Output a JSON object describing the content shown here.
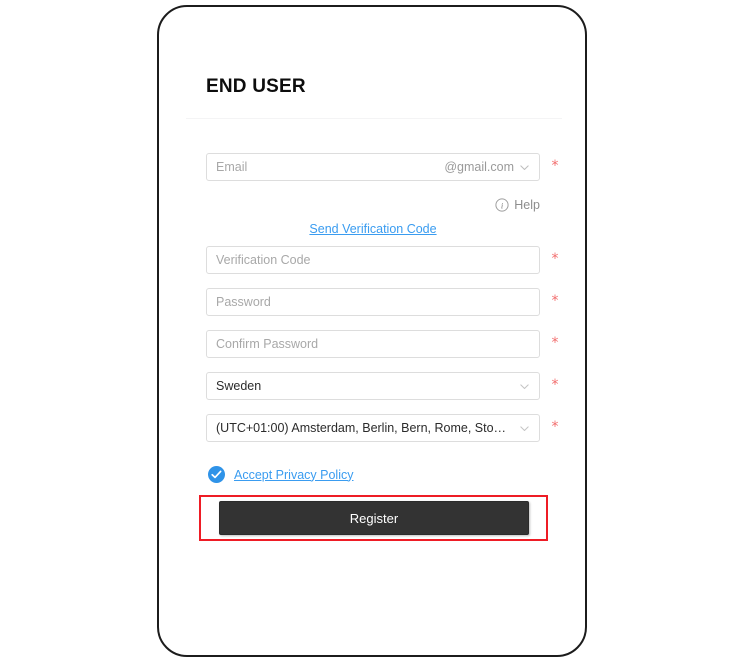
{
  "page": {
    "title": "END USER",
    "accent_link_color": "#3a9cf0",
    "required_star_color": "#f26d6d",
    "highlight_color": "#ee1c25",
    "button_color": "#333333",
    "checkbox_color": "#2f93e8"
  },
  "email": {
    "placeholder": "Email",
    "domain_suffix": "@gmail.com",
    "required_mark": "*",
    "chevron_icon": "chevron-down-icon"
  },
  "help": {
    "icon": "info-circle-icon",
    "label": "Help"
  },
  "send_code": {
    "label": "Send Verification Code"
  },
  "fields": [
    {
      "name": "verification-code",
      "placeholder": "Verification Code",
      "required_mark": "*"
    },
    {
      "name": "password",
      "placeholder": "Password",
      "required_mark": "*"
    },
    {
      "name": "confirm-password",
      "placeholder": "Confirm Password",
      "required_mark": "*"
    }
  ],
  "country": {
    "value": "Sweden",
    "required_mark": "*",
    "chevron_icon": "chevron-down-icon"
  },
  "timezone": {
    "value": "(UTC+01:00) Amsterdam, Berlin, Bern, Rome, Sto…",
    "required_mark": "*",
    "chevron_icon": "chevron-down-icon"
  },
  "privacy": {
    "checkbox_icon": "check-circle-icon",
    "checked": true,
    "label": "Accept Privacy Policy"
  },
  "register": {
    "label": "Register"
  }
}
